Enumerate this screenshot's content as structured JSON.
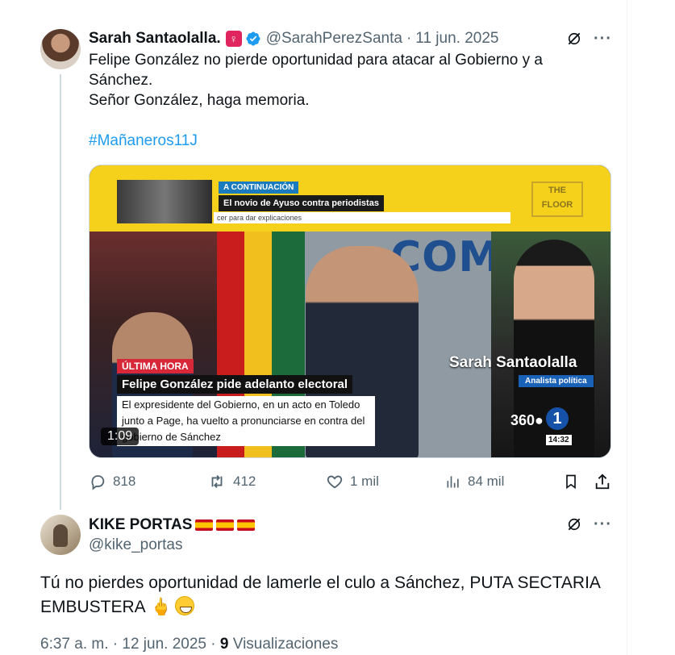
{
  "tweet": {
    "author_name": "Sarah Santaolalla.",
    "female_badge": "♀",
    "handle": "@SarahPerezSanta",
    "separator": "·",
    "date": "11 jun. 2025",
    "text_lines": [
      "Felipe González no pierde oportunidad para atacar al Gobierno y a",
      "Sánchez.",
      "Señor González, haga memoria."
    ],
    "hashtag": "#Mañaneros11J",
    "media": {
      "banner_continuation": "A CONTINUACIÓN",
      "banner_headline": "El novio de Ayuso contra periodistas",
      "banner_ticker": "cer para dar explicaciones",
      "floor_logo": "THE FLOOR",
      "lower_third_tag": "ÚLTIMA HORA",
      "lower_third_headline": "Felipe González pide adelanto electoral",
      "lower_third_sub": "El expresidente del Gobierno, en un acto en Toledo junto a Page, ha vuelto a pronunciarse en contra del gobierno de Sánchez",
      "background_text": "COMP",
      "guest_name": "Sarah Santaolalla",
      "guest_role": "Analista política",
      "channel_360": "360●",
      "channel_one": "1",
      "clock": "14:32",
      "duration": "1:09"
    },
    "actions": {
      "replies": "818",
      "reposts": "412",
      "likes": "1 mil",
      "views": "84 mil"
    }
  },
  "reply": {
    "author_name": "KIKE PORTAS",
    "handle": "@kike_portas",
    "text": "Tú no pierdes oportunidad de lamerle el culo a Sánchez,  PUTA SECTARIA EMBUSTERA",
    "emoji_finger": "🖕",
    "time": "6:37 a. m.",
    "date": "12 jun. 2025",
    "views_count": "9",
    "views_label": "Visualizaciones"
  },
  "icons": {
    "verified": "verified-badge-icon",
    "grok": "grok-icon",
    "more": "more-icon",
    "reply": "reply-icon",
    "repost": "repost-icon",
    "like": "heart-icon",
    "views": "views-icon",
    "bookmark": "bookmark-icon",
    "share": "share-icon"
  },
  "colors": {
    "accent": "#1d9bf0",
    "muted": "#536471",
    "text": "#0f1419",
    "thread_line": "#cfd9de"
  }
}
